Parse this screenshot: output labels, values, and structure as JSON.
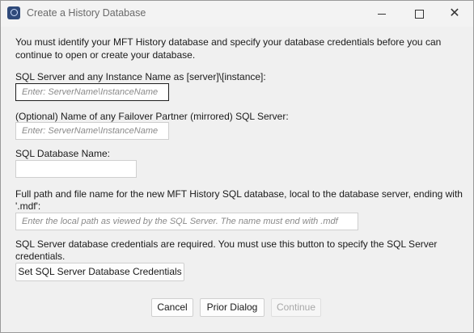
{
  "window": {
    "title": "Create a History Database",
    "controls": [
      "minimize",
      "maximize",
      "close"
    ],
    "close_glyph": "✕"
  },
  "intro": {
    "line1": "You must identify your MFT History database and specify your database credentials before you can",
    "line2": "continue to open or create your database."
  },
  "server": {
    "label": "SQL Server and any Instance Name as [server]\\[instance]:",
    "placeholder": "Enter: ServerName\\InstanceName"
  },
  "failover": {
    "label": "(Optional) Name of any Failover Partner (mirrored) SQL Server:",
    "placeholder": "Enter: ServerName\\InstanceName"
  },
  "dbname": {
    "label": "SQL Database Name:",
    "value": ""
  },
  "path": {
    "label_line1": "Full path and file name for the new MFT History SQL database, local to the database server, ending with",
    "label_line2": "'.mdf':",
    "placeholder": "Enter the local path as viewed by the SQL Server. The name must end with .mdf"
  },
  "credentials": {
    "note_line1": "SQL Server database credentials are required. You must use this button to specify the SQL Server",
    "note_line2": "credentials.",
    "button": "Set SQL Server Database Credentials"
  },
  "footer": {
    "cancel": "Cancel",
    "prior": "Prior Dialog",
    "continue": "Continue"
  }
}
